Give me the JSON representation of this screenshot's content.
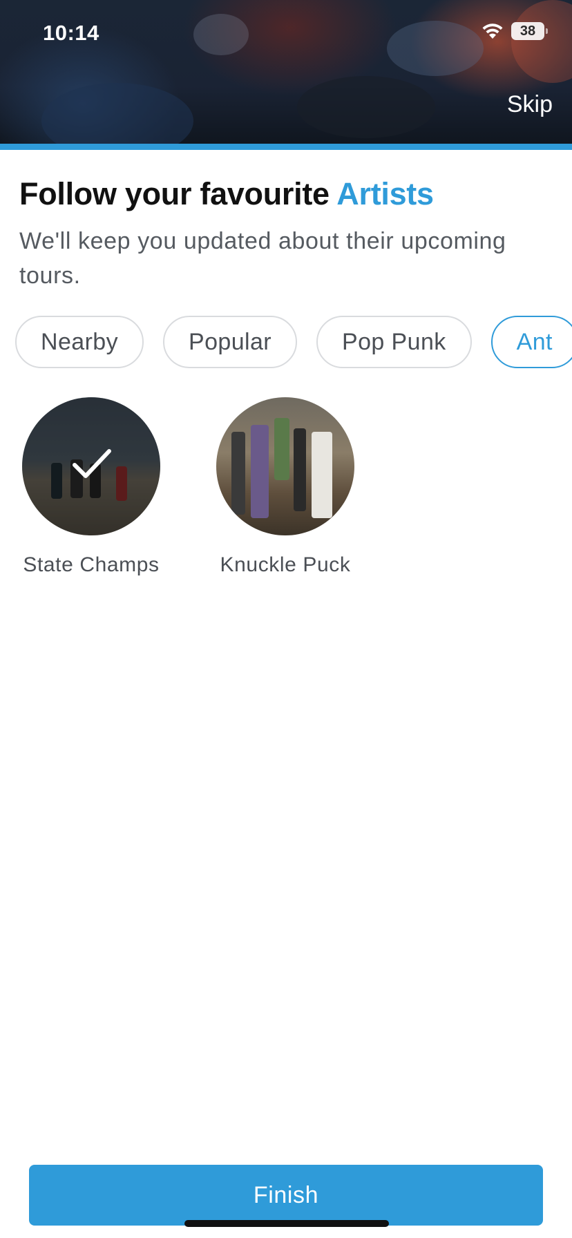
{
  "status_bar": {
    "time": "10:14",
    "battery_level": "38",
    "wifi_icon": "wifi-icon"
  },
  "header": {
    "skip_label": "Skip",
    "accent_color": "#2f9bd9"
  },
  "heading": {
    "title_prefix": "Follow your favourite",
    "title_accent": "Artists",
    "subtitle": "We'll keep you updated about their upcoming tours."
  },
  "categories": [
    {
      "label": "Nearby",
      "selected": false
    },
    {
      "label": "Popular",
      "selected": false
    },
    {
      "label": "Pop Punk",
      "selected": false
    },
    {
      "label": "Ant",
      "selected": true
    }
  ],
  "artists": [
    {
      "name": "State Champs",
      "selected": true
    },
    {
      "name": "Knuckle Puck",
      "selected": false
    }
  ],
  "footer": {
    "finish_label": "Finish"
  }
}
